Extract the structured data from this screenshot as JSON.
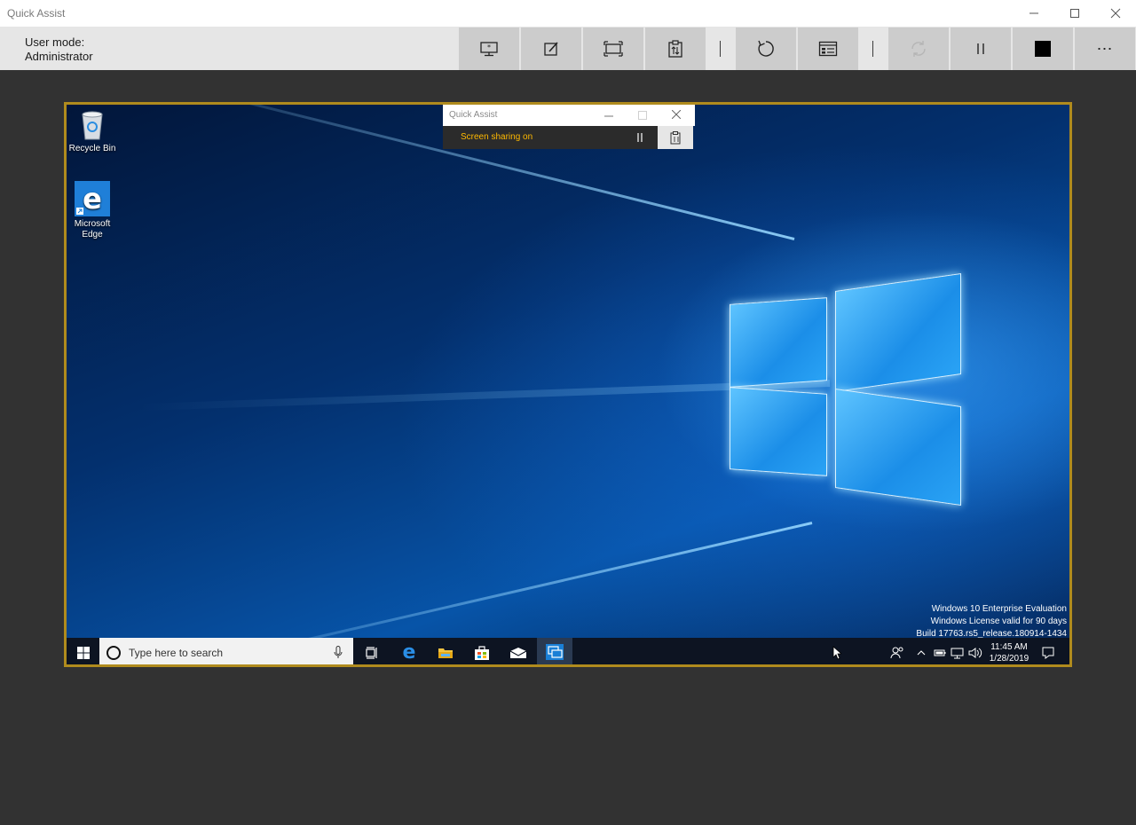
{
  "window": {
    "title": "Quick Assist",
    "controls": [
      "minimize-icon",
      "maximize-icon",
      "close-icon"
    ]
  },
  "toolbar": {
    "user_mode_label": "User mode:",
    "user_mode_value": "Administrator",
    "buttons": [
      {
        "name": "select-monitor-button",
        "icon": "monitor-icon"
      },
      {
        "name": "annotate-button",
        "icon": "pen-icon"
      },
      {
        "name": "actual-size-button",
        "icon": "fit-screen-icon"
      },
      {
        "name": "toggle-instruction-channel-button",
        "icon": "clipboard-icon"
      },
      {
        "name": "restart-button",
        "icon": "restart-icon"
      },
      {
        "name": "task-manager-button",
        "icon": "task-manager-icon"
      },
      {
        "name": "reconnect-button",
        "icon": "reconnect-icon",
        "disabled": true
      },
      {
        "name": "pause-button",
        "icon": "pause-icon"
      },
      {
        "name": "end-button",
        "icon": "stop-icon"
      },
      {
        "name": "more-button",
        "icon": "more-icon",
        "label": "⋯"
      }
    ]
  },
  "remote": {
    "border_color": "#b08b1d",
    "desktop_icons": [
      {
        "label": "Recycle Bin",
        "icon": "recycle-bin-icon"
      },
      {
        "label": "Microsoft\nEdge",
        "icon": "edge-icon"
      }
    ],
    "quick_assist_window": {
      "title": "Quick Assist",
      "status": "Screen sharing on",
      "status_color": "#ffb900"
    },
    "watermark": {
      "line1": "Windows 10 Enterprise Evaluation",
      "line2": "Windows License valid for 90 days",
      "line3": "Build 17763.rs5_release.180914-1434"
    },
    "taskbar": {
      "search_placeholder": "Type here to search",
      "time": "11:45 AM",
      "date": "1/28/2019",
      "apps": [
        "task-view-icon",
        "edge-icon",
        "file-explorer-icon",
        "store-icon",
        "mail-icon",
        "quick-assist-icon"
      ]
    }
  }
}
